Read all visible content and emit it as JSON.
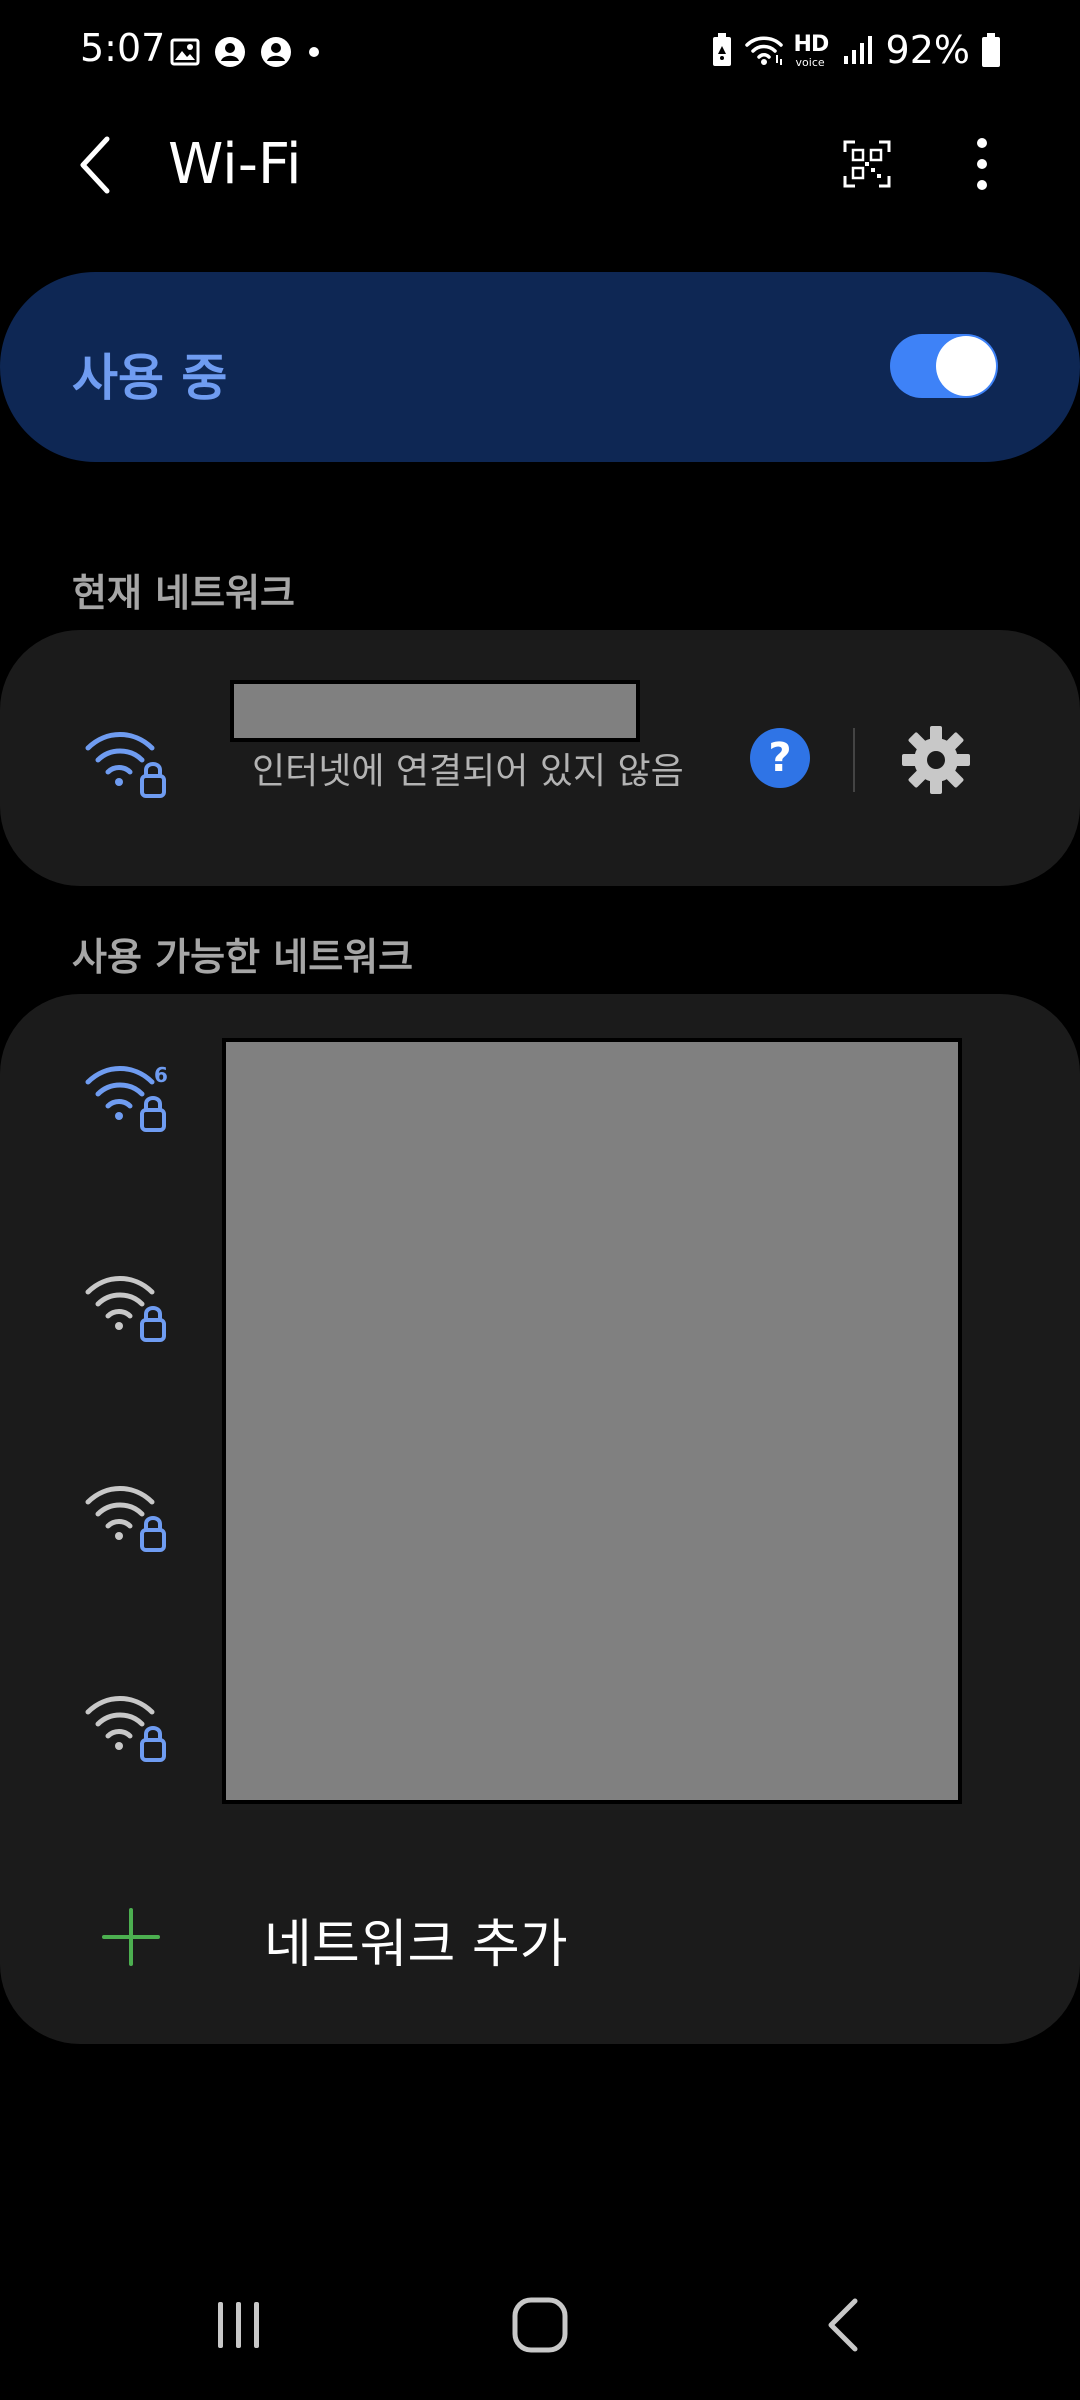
{
  "status_bar": {
    "time": "5:07",
    "battery": "92%",
    "hd": "HD",
    "voice": "voice",
    "icons": [
      "gallery-icon",
      "account-icon",
      "account-icon",
      "dot-icon",
      "battery-saver-icon",
      "wifi-status-icon",
      "signal-icon",
      "battery-icon"
    ]
  },
  "app_bar": {
    "title": "Wi-Fi",
    "back_icon": "back-arrow-icon",
    "qr_icon": "qr-scan-icon",
    "more_icon": "more-vertical-icon"
  },
  "master_switch": {
    "label": "사용 중",
    "state": "on",
    "accent": "#3e82f7"
  },
  "current_network": {
    "section_label": "현재 네트워크",
    "status": "인터넷에 연결되어 있지 않음",
    "help_glyph": "?",
    "icon": "wifi-locked-icon",
    "icon_color": "#6f9cf1"
  },
  "available_networks": {
    "section_label": "사용 가능한 네트워크",
    "networks": [
      {
        "icon": "wifi6-locked-icon",
        "color": "#6f9cf1",
        "badge": "6"
      },
      {
        "icon": "wifi-locked-icon",
        "color": "#c8c8c8",
        "badge": ""
      },
      {
        "icon": "wifi-locked-icon",
        "color": "#c8c8c8",
        "badge": ""
      },
      {
        "icon": "wifi-locked-icon",
        "color": "#c8c8c8",
        "badge": ""
      }
    ],
    "add_label": "네트워크 추가",
    "add_icon_color": "#4caf50"
  },
  "nav_bar": {
    "icons": [
      "recents-icon",
      "home-icon",
      "back-nav-icon"
    ]
  }
}
